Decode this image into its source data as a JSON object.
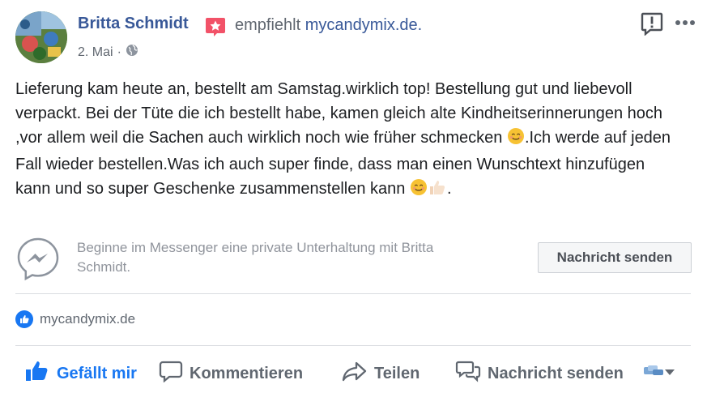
{
  "post": {
    "author": "Britta Schmidt",
    "recommends_text": "empfiehlt",
    "page_link": "mycandymix.de.",
    "date": "2. Mai",
    "dot": "·",
    "body_parts": [
      "Lieferung kam heute an, bestellt am Samstag.wirklich top! Bestellung gut und liebevoll verpackt. Bei der Tüte die ich bestellt habe, kamen gleich alte Kindheitserinnerungen hoch ,vor allem weil die Sachen auch wirklich noch wie früher schmecken ",
      ".Ich werde auf jeden Fall wieder bestellen.Was ich auch super finde, dass man einen Wunschtext hinzufügen kann und so super Geschenke zusammenstellen kann ",
      "."
    ],
    "emojis": [
      "smiling-face-emoji",
      "smiling-face-emoji",
      "thumbs-up-emoji"
    ]
  },
  "messenger": {
    "prompt": "Beginne im Messenger eine private Unterhaltung mit Britta Schmidt.",
    "button_label": "Nachricht senden"
  },
  "likes": {
    "page": "mycandymix.de"
  },
  "actions": {
    "like": "Gefällt mir",
    "comment": "Kommentieren",
    "share": "Teilen",
    "message": "Nachricht senden"
  },
  "colors": {
    "link": "#385898",
    "like_blue": "#1877f2",
    "muted": "#606770",
    "badge_red": "#f25268"
  },
  "icons": [
    "globe-icon",
    "report-icon",
    "more-icon",
    "messenger-icon",
    "thumbs-up-icon",
    "comment-icon",
    "share-icon",
    "chat-icon",
    "audience-icon",
    "chevron-down-icon",
    "recommendation-star-icon"
  ]
}
